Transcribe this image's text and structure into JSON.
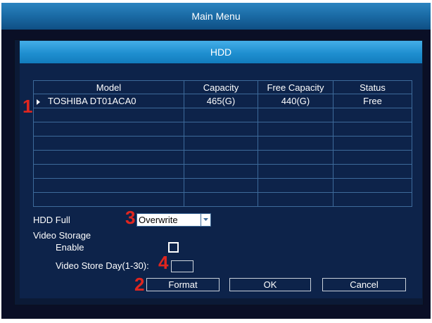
{
  "window": {
    "title": "Main Menu"
  },
  "panel": {
    "title": "HDD"
  },
  "table": {
    "headers": [
      "Model",
      "Capacity",
      "Free Capacity",
      "Status"
    ],
    "rows": [
      [
        "TOSHIBA DT01ACA0",
        "465(G)",
        "440(G)",
        "Free"
      ]
    ]
  },
  "settings": {
    "hdd_full_label": "HDD Full",
    "hdd_full_value": "Overwrite",
    "video_storage_label": "Video Storage",
    "enable_label": "Enable",
    "enable_checked": false,
    "store_day_label": "Video Store Day(1-30):",
    "store_day_value": ""
  },
  "buttons": {
    "format": "Format",
    "ok": "OK",
    "cancel": "Cancel"
  },
  "annotations": [
    "1",
    "2",
    "3",
    "4"
  ],
  "colors": {
    "title_bar": "#1a6aa4",
    "panel_bar": "#1f8fd0",
    "panel_bg": "#0d234a",
    "grid_line": "#3d6a9a",
    "annotation": "#e0261f"
  }
}
